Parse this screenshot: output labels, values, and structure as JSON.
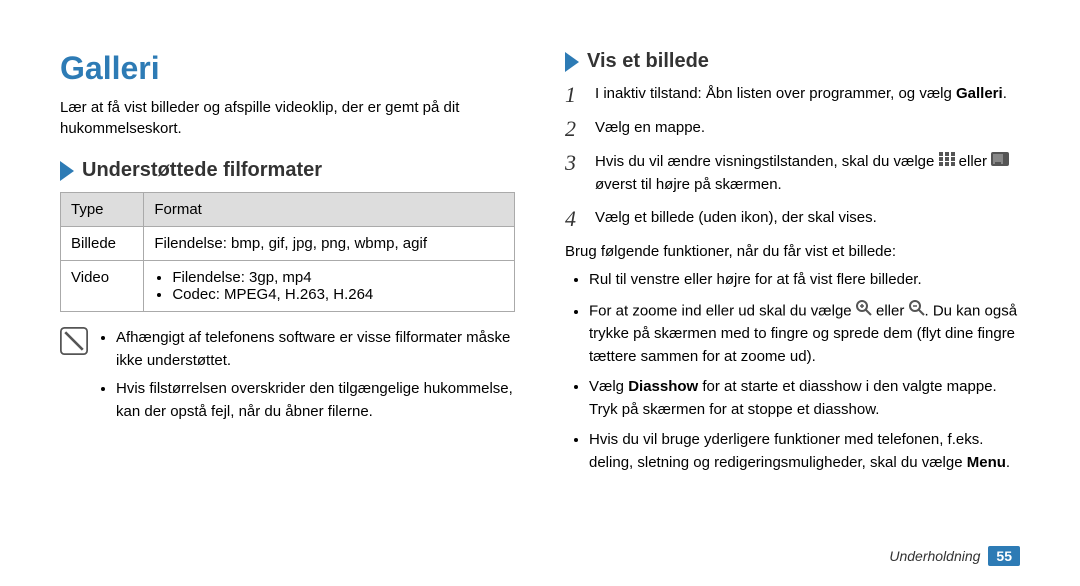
{
  "title": "Galleri",
  "intro": "Lær at få vist billeder og afspille videoklip, der er gemt på dit hukommelseskort.",
  "subhead1": "Understøttede filformater",
  "table": {
    "headers": [
      "Type",
      "Format"
    ],
    "rows": [
      {
        "type": "Billede",
        "format_text": "Filendelse: bmp, gif, jpg, png, wbmp, agif"
      },
      {
        "type": "Video",
        "format_items": [
          "Filendelse: 3gp, mp4",
          "Codec: MPEG4, H.263, H.264"
        ]
      }
    ]
  },
  "note_items": [
    "Afhængigt af telefonens software er visse filformater måske ikke understøttet.",
    "Hvis filstørrelsen overskrider den tilgængelige hukommelse, kan der opstå fejl, når du åbner filerne."
  ],
  "subhead2": "Vis et billede",
  "steps": [
    {
      "num": "1",
      "parts": [
        "I inaktiv tilstand: Åbn listen over programmer, og vælg ",
        {
          "bold": "Galleri"
        },
        "."
      ]
    },
    {
      "num": "2",
      "parts": [
        "Vælg en mappe."
      ]
    },
    {
      "num": "3",
      "parts": [
        "Hvis du vil ændre visningstilstanden, skal du vælge ",
        {
          "icon": "grid-icon"
        },
        " eller ",
        {
          "icon": "list-icon"
        },
        " øverst til højre på skærmen."
      ]
    },
    {
      "num": "4",
      "parts": [
        "Vælg et billede (uden ikon), der skal vises."
      ]
    }
  ],
  "post_steps": "Brug følgende funktioner, når du får vist et billede:",
  "feature_list": [
    {
      "parts": [
        "Rul til venstre eller højre for at få vist flere billeder."
      ]
    },
    {
      "parts": [
        "For at zoome ind eller ud skal du vælge ",
        {
          "icon": "zoom-in-icon"
        },
        " eller ",
        {
          "icon": "zoom-out-icon"
        },
        ". Du kan også trykke på skærmen med to fingre og sprede dem (flyt dine fingre tættere sammen for at zoome ud)."
      ]
    },
    {
      "parts": [
        "Vælg ",
        {
          "bold": "Diasshow"
        },
        " for at starte et diasshow i den valgte mappe. Tryk på skærmen for at stoppe et diasshow."
      ]
    },
    {
      "parts": [
        "Hvis du vil bruge yderligere funktioner med telefonen, f.eks. deling, sletning og redigeringsmuligheder, skal du vælge ",
        {
          "bold": "Menu"
        },
        "."
      ]
    }
  ],
  "footer_section": "Underholdning",
  "page_number": "55"
}
